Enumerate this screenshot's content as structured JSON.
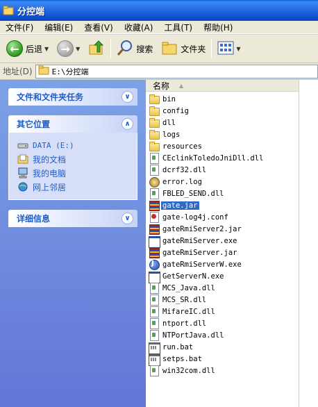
{
  "window": {
    "title": "分控端"
  },
  "menubar": {
    "items": [
      "文件(F)",
      "编辑(E)",
      "查看(V)",
      "收藏(A)",
      "工具(T)",
      "帮助(H)"
    ]
  },
  "toolbar": {
    "back_label": "后退",
    "search_label": "搜索",
    "folders_label": "文件夹"
  },
  "address": {
    "label": "地址(D)",
    "value": "E:\\分控端"
  },
  "tasks": {
    "file_folder_tasks": {
      "title": "文件和文件夹任务"
    },
    "other_places": {
      "title": "其它位置",
      "items": [
        "DATA (E:)",
        "我的文档",
        "我的电脑",
        "网上邻居"
      ]
    },
    "details": {
      "title": "详细信息"
    }
  },
  "filelist": {
    "column_name": "名称",
    "selected": "gate.jar",
    "files": [
      {
        "name": "bin",
        "type": "folder"
      },
      {
        "name": "config",
        "type": "folder"
      },
      {
        "name": "dll",
        "type": "folder"
      },
      {
        "name": "logs",
        "type": "folder"
      },
      {
        "name": "resources",
        "type": "folder"
      },
      {
        "name": "CEclinkToledoJniDll.dll",
        "type": "dll"
      },
      {
        "name": "dcrf32.dll",
        "type": "dll"
      },
      {
        "name": "error.log",
        "type": "log"
      },
      {
        "name": "FBLED_SEND.dll",
        "type": "dll"
      },
      {
        "name": "gate.jar",
        "type": "jar"
      },
      {
        "name": "gate-log4j.conf",
        "type": "conf"
      },
      {
        "name": "gateRmiServer2.jar",
        "type": "jar"
      },
      {
        "name": "gateRmiServer.exe",
        "type": "exe"
      },
      {
        "name": "gateRmiServer.jar",
        "type": "jar"
      },
      {
        "name": "gateRmiServerW.exe",
        "type": "exej"
      },
      {
        "name": "GetServerN.exe",
        "type": "exe"
      },
      {
        "name": "MCS_Java.dll",
        "type": "dll"
      },
      {
        "name": "MCS_SR.dll",
        "type": "dll"
      },
      {
        "name": "MifareIC.dll",
        "type": "dll"
      },
      {
        "name": "ntport.dll",
        "type": "dll"
      },
      {
        "name": "NTPortJava.dll",
        "type": "dll"
      },
      {
        "name": "run.bat",
        "type": "bat"
      },
      {
        "name": "setps.bat",
        "type": "bat"
      },
      {
        "name": "win32com.dll",
        "type": "dll"
      }
    ]
  }
}
